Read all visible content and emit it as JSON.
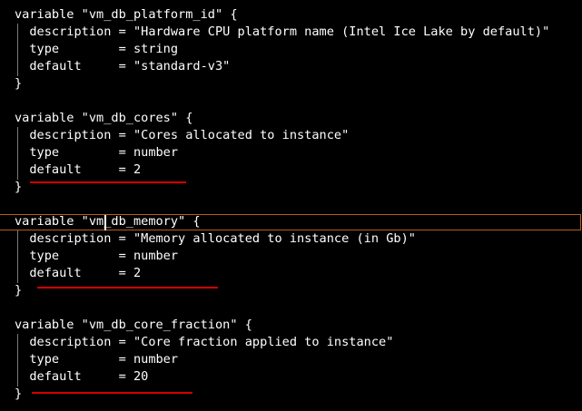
{
  "editor": {
    "lines": [
      "variable \"vm_db_platform_id\" {",
      "  description = \"Hardware CPU platform name (Intel Ice Lake by default)\"",
      "  type        = string",
      "  default     = \"standard-v3\"",
      "}",
      "",
      "variable \"vm_db_cores\" {",
      "  description = \"Cores allocated to instance\"",
      "  type        = number",
      "  default     = 2",
      "}",
      "",
      "variable \"vm_db_memory\" {",
      "  description = \"Memory allocated to instance (in Gb)\"",
      "  type        = number",
      "  default     = 2",
      "}",
      "",
      "variable \"vm_db_core_fraction\" {",
      "  description = \"Core fraction applied to instance\"",
      "  type        = number",
      "  default     = 20",
      "}"
    ]
  },
  "colors": {
    "background": "#000000",
    "text": "#ffffff",
    "underline": "#d40000",
    "cursorline": "#b85c1c",
    "guide": "#7a7a7a"
  }
}
